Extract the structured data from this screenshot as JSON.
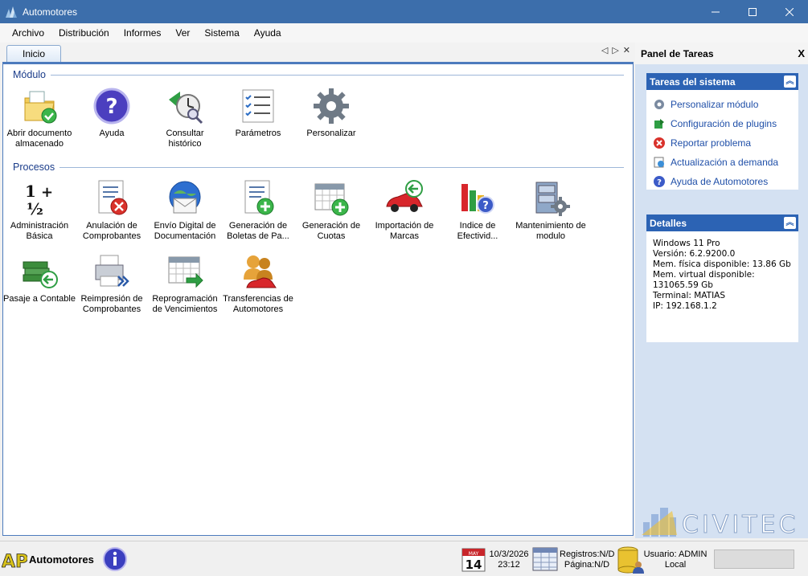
{
  "window": {
    "title": "Automotores"
  },
  "menu": [
    "Archivo",
    "Distribución",
    "Informes",
    "Ver",
    "Sistema",
    "Ayuda"
  ],
  "tabs": [
    {
      "label": "Inicio"
    }
  ],
  "sections": {
    "modulo": {
      "title": "Módulo",
      "items": [
        {
          "label": "Abrir documento almacenado",
          "icon": "folder-check-icon"
        },
        {
          "label": "Ayuda",
          "icon": "help-icon"
        },
        {
          "label": "Consultar histórico",
          "icon": "clock-history-icon"
        },
        {
          "label": "Parámetros",
          "icon": "checklist-icon"
        },
        {
          "label": "Personalizar",
          "icon": "gear-icon"
        }
      ]
    },
    "procesos": {
      "title": "Procesos",
      "items": [
        {
          "label": "Administración Básica",
          "icon": "numbers-icon"
        },
        {
          "label": "Anulación de Comprobantes",
          "icon": "document-cancel-icon"
        },
        {
          "label": "Envío Digital de Documentación",
          "icon": "globe-mail-icon"
        },
        {
          "label": "Generación de Boletas de Pa...",
          "icon": "document-add-icon"
        },
        {
          "label": "Generación de Cuotas",
          "icon": "calendar-add-icon"
        },
        {
          "label": "Importación de Marcas",
          "icon": "car-import-icon"
        },
        {
          "label": "Indice de Efectivid...",
          "icon": "chart-help-icon"
        },
        {
          "label": "Mantenimiento de modulo",
          "icon": "cabinet-gear-icon"
        },
        {
          "label": "Pasaje a Contable",
          "icon": "books-back-icon"
        },
        {
          "label": "Reimpresión de Comprobantes",
          "icon": "printer-icon"
        },
        {
          "label": "Reprogramación de Vencimientos",
          "icon": "calendar-arrow-icon"
        },
        {
          "label": "Transferencias de Automotores",
          "icon": "people-car-icon"
        }
      ]
    }
  },
  "task_panel": {
    "title": "Panel de Tareas",
    "close_label": "X",
    "system_tasks": {
      "title": "Tareas del sistema",
      "items": [
        "Personalizar módulo",
        "Configuración de plugins",
        "Reportar problema",
        "Actualización a demanda",
        "Ayuda de Automotores"
      ]
    },
    "details": {
      "title": "Detalles",
      "lines": [
        "Windows 11 Pro",
        "Versión: 6.2.9200.0",
        "Mem. física disponible: 13.86 Gb",
        "Mem. virtual disponible:",
        "131065.59 Gb",
        "Terminal: MATIAS",
        "IP: 192.168.1.2"
      ]
    },
    "brand": "CIVITEC"
  },
  "status": {
    "logo_text": "API",
    "app_name": "Automotores",
    "calendar_month": "MAY",
    "calendar_day": "14",
    "date": "10/3/2026",
    "time": "23:12",
    "registros": "Registros:N/D",
    "pagina": "Página:N/D",
    "usuario": "Usuario: ADMIN",
    "location": "Local"
  },
  "colors": {
    "accent": "#2c63b4",
    "titlebar": "#3c6eab",
    "link": "#1f4fa8"
  }
}
